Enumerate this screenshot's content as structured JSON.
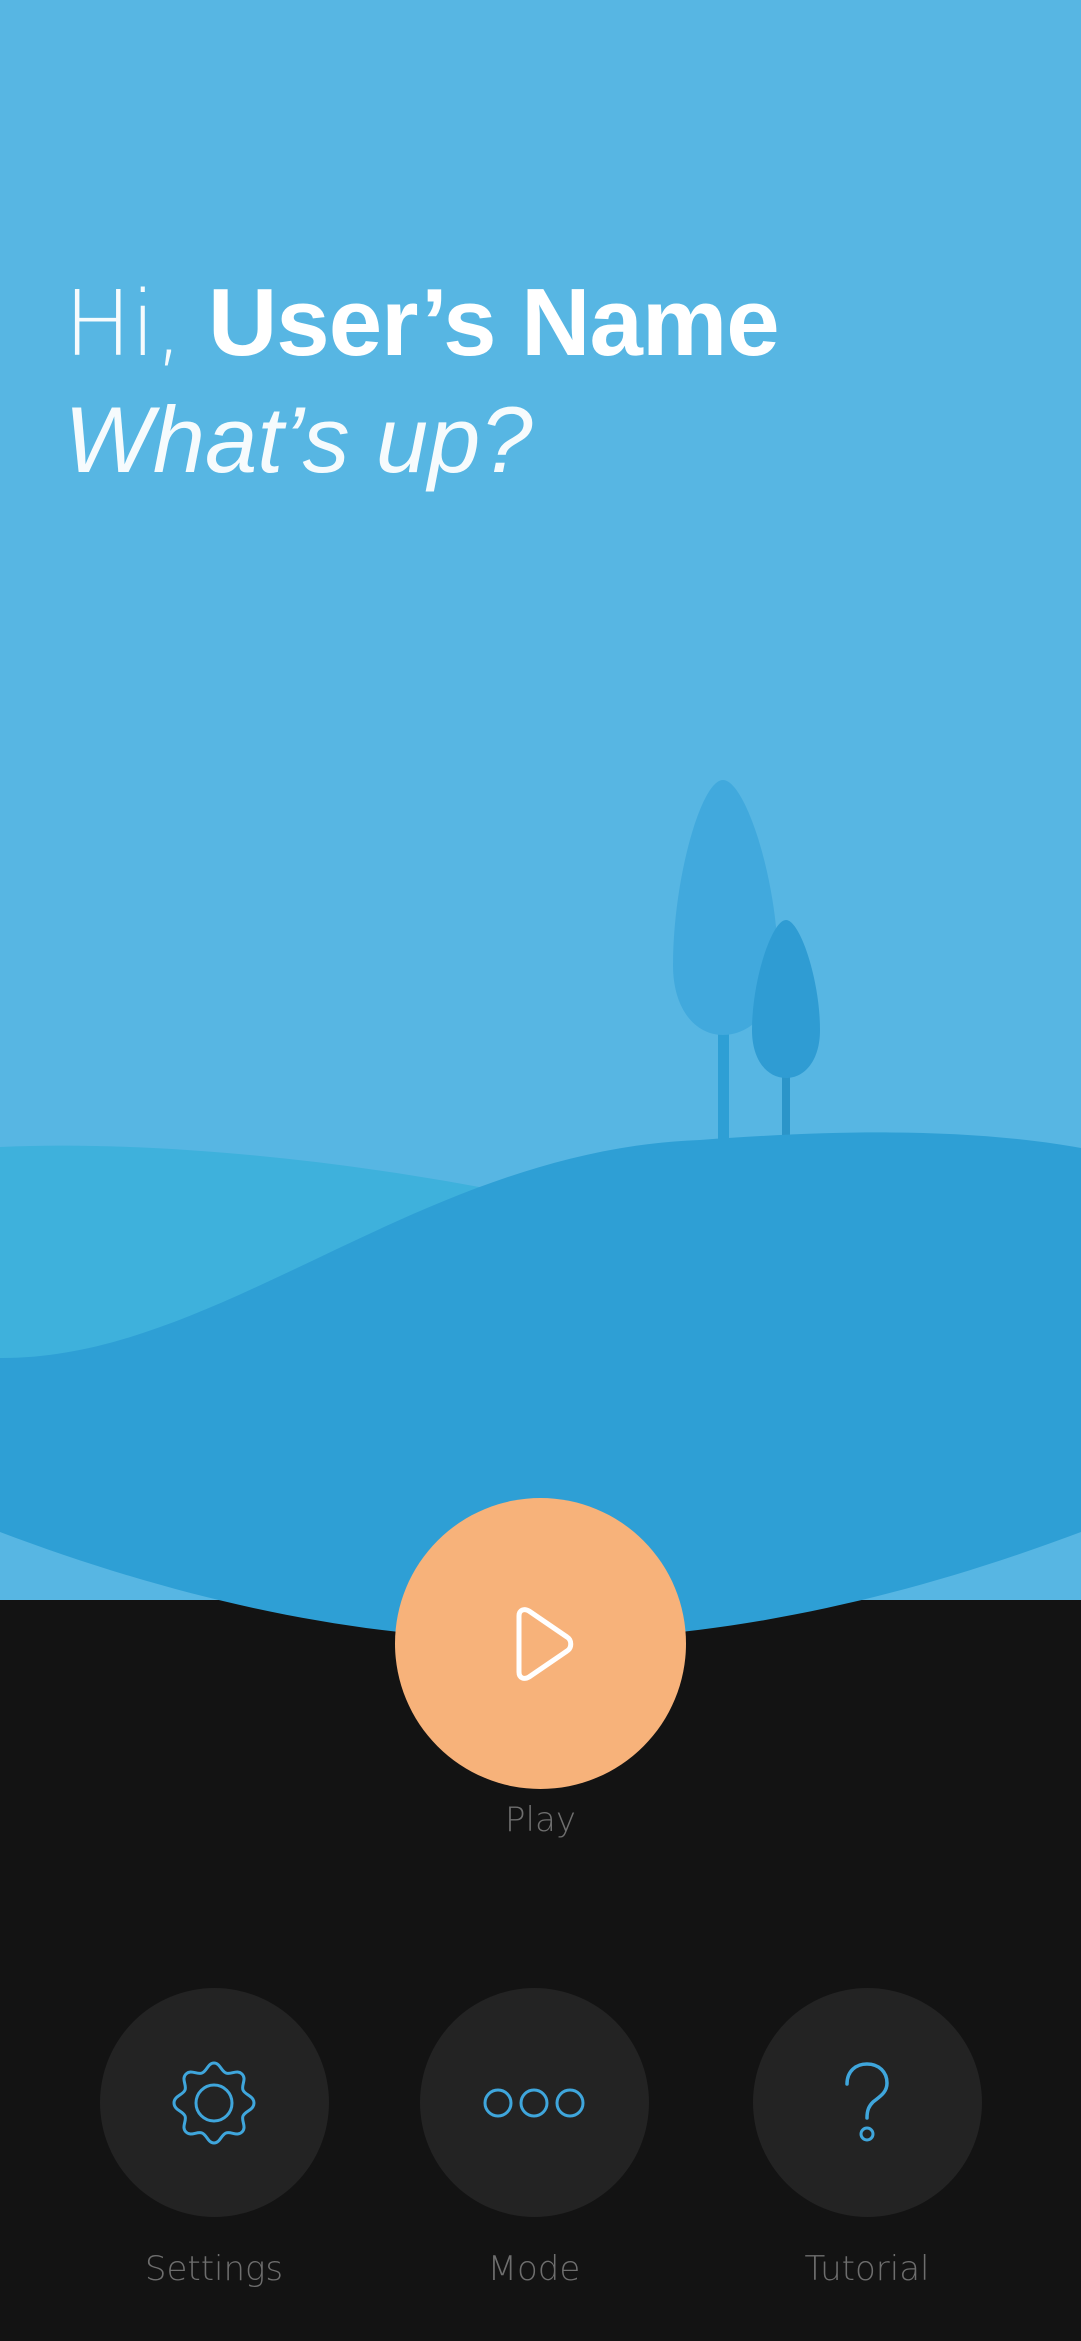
{
  "greeting": {
    "hi": "Hi,",
    "name": "User’s Name",
    "question": "What’s up?"
  },
  "play": {
    "label": "Play",
    "icon": "play-icon"
  },
  "nav": [
    {
      "label": "Settings",
      "icon": "gear-icon"
    },
    {
      "label": "Mode",
      "icon": "three-dots-icon"
    },
    {
      "label": "Tutorial",
      "icon": "question-mark-icon"
    }
  ],
  "colors": {
    "sky": "#57b6e3",
    "hill_back": "#3eb1dc",
    "hill_front": "#2e9fd5",
    "tree_tall": "#41a9dd",
    "tree_short": "#2f9cd3",
    "dark_bg": "#131313",
    "nav_circle": "#232323",
    "play_accent": "#f7b27a",
    "icon_blue": "#3fa6dc",
    "label_gray": "#6e6e6e"
  }
}
